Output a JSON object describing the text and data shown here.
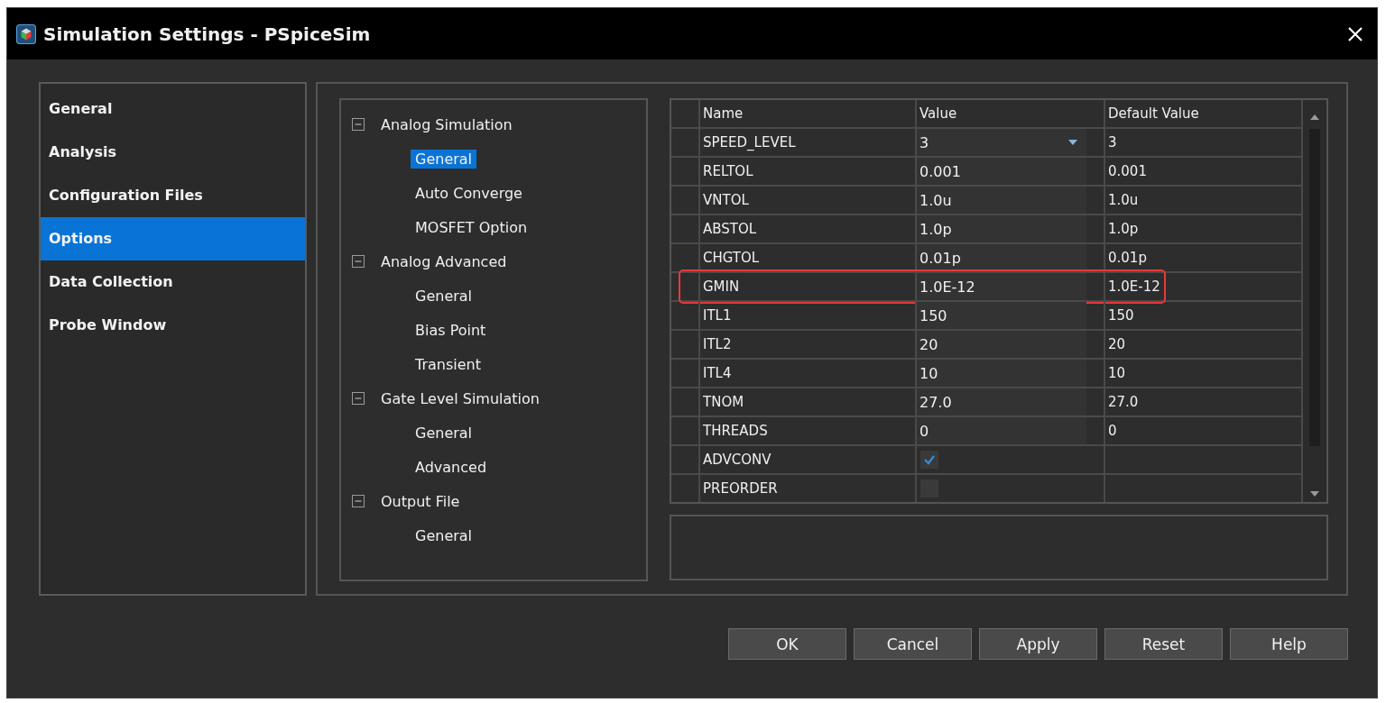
{
  "window": {
    "title": "Simulation Settings - PSpiceSim"
  },
  "sidebar": {
    "items": [
      {
        "label": "General",
        "selected": false
      },
      {
        "label": "Analysis",
        "selected": false
      },
      {
        "label": "Configuration Files",
        "selected": false
      },
      {
        "label": "Options",
        "selected": true
      },
      {
        "label": "Data Collection",
        "selected": false
      },
      {
        "label": "Probe Window",
        "selected": false
      }
    ]
  },
  "tree": [
    {
      "label": "Analog Simulation",
      "expanded": true,
      "children": [
        {
          "label": "General",
          "selected": true
        },
        {
          "label": "Auto Converge",
          "selected": false
        },
        {
          "label": "MOSFET Option",
          "selected": false
        }
      ]
    },
    {
      "label": "Analog Advanced",
      "expanded": true,
      "children": [
        {
          "label": "General",
          "selected": false
        },
        {
          "label": "Bias Point",
          "selected": false
        },
        {
          "label": "Transient",
          "selected": false
        }
      ]
    },
    {
      "label": "Gate Level Simulation",
      "expanded": true,
      "children": [
        {
          "label": "General",
          "selected": false
        },
        {
          "label": "Advanced",
          "selected": false
        }
      ]
    },
    {
      "label": "Output File",
      "expanded": true,
      "children": [
        {
          "label": "General",
          "selected": false
        }
      ]
    }
  ],
  "table": {
    "columns": [
      "Name",
      "Value",
      "Default Value"
    ],
    "rows": [
      {
        "name": "SPEED_LEVEL",
        "kind": "dropdown",
        "value": "3",
        "default": "3",
        "highlighted": false
      },
      {
        "name": "RELTOL",
        "kind": "text",
        "value": "0.001",
        "default": "0.001",
        "highlighted": false
      },
      {
        "name": "VNTOL",
        "kind": "text",
        "value": "1.0u",
        "default": "1.0u",
        "highlighted": false
      },
      {
        "name": "ABSTOL",
        "kind": "text",
        "value": "1.0p",
        "default": "1.0p",
        "highlighted": false
      },
      {
        "name": "CHGTOL",
        "kind": "text",
        "value": "0.01p",
        "default": "0.01p",
        "highlighted": false
      },
      {
        "name": "GMIN",
        "kind": "text",
        "value": "1.0E-12",
        "default": "1.0E-12",
        "highlighted": true
      },
      {
        "name": "ITL1",
        "kind": "text",
        "value": "150",
        "default": "150",
        "highlighted": false
      },
      {
        "name": "ITL2",
        "kind": "text",
        "value": "20",
        "default": "20",
        "highlighted": false
      },
      {
        "name": "ITL4",
        "kind": "text",
        "value": "10",
        "default": "10",
        "highlighted": false
      },
      {
        "name": "TNOM",
        "kind": "text",
        "value": "27.0",
        "default": "27.0",
        "highlighted": false
      },
      {
        "name": "THREADS",
        "kind": "text",
        "value": "0",
        "default": "0",
        "highlighted": false
      },
      {
        "name": "ADVCONV",
        "kind": "checkbox",
        "checked": true,
        "highlighted": false
      },
      {
        "name": "PREORDER",
        "kind": "checkbox",
        "checked": false,
        "highlighted": false
      }
    ]
  },
  "buttons": [
    "OK",
    "Cancel",
    "Apply",
    "Reset",
    "Help"
  ]
}
